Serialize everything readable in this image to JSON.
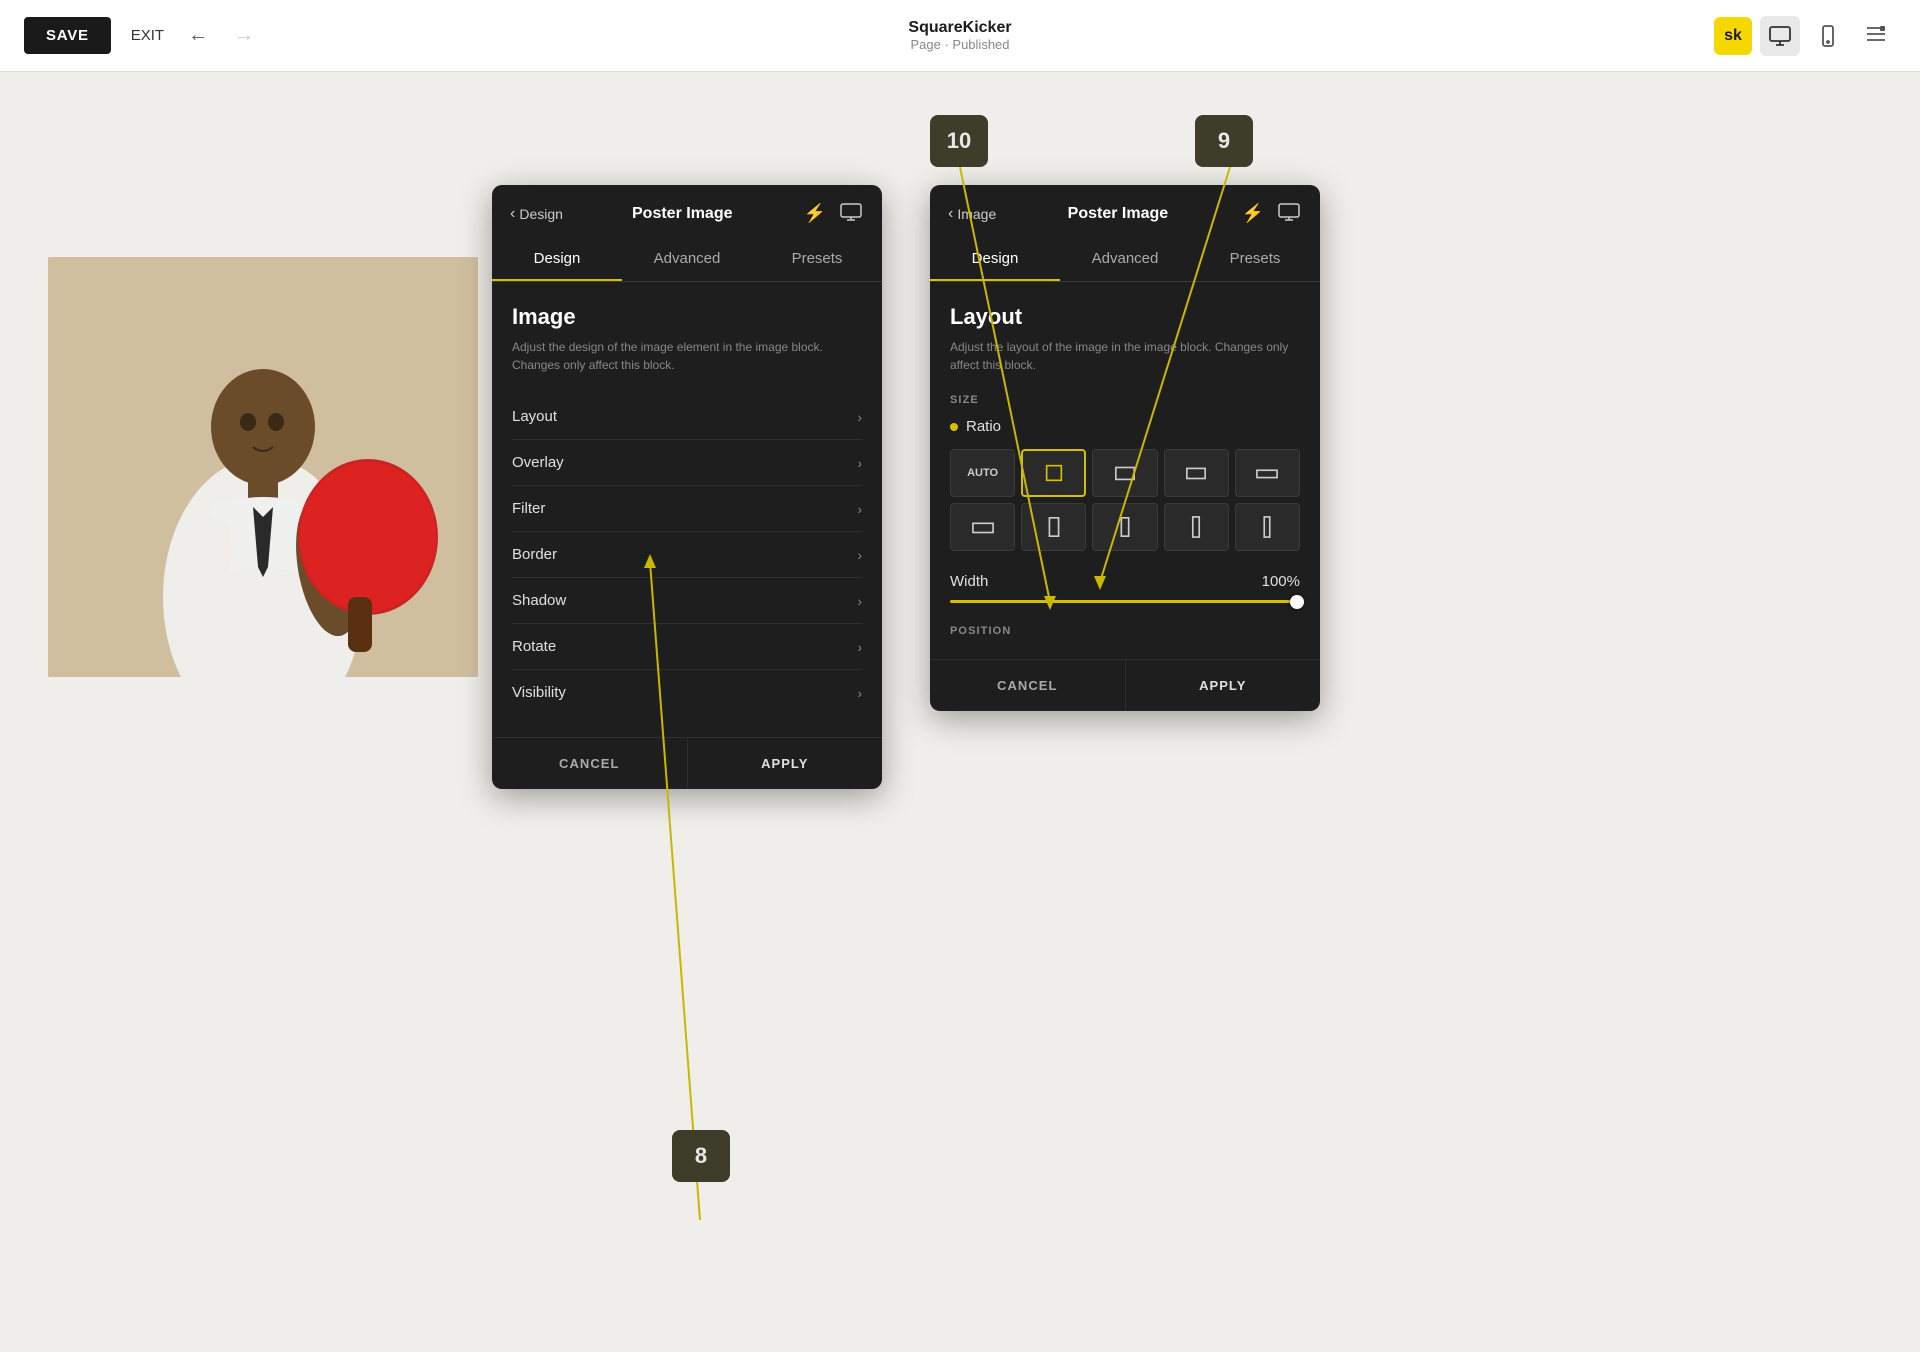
{
  "topbar": {
    "save_label": "SAVE",
    "exit_label": "EXIT",
    "title": "SquareKicker",
    "subtitle": "Page · Published",
    "sk_logo": "sk"
  },
  "left_panel": {
    "back_label": "Design",
    "title": "Poster Image",
    "tabs": [
      "Design",
      "Advanced",
      "Presets"
    ],
    "active_tab": 0,
    "section_title": "Image",
    "section_desc": "Adjust the design of the image element in the image block. Changes only affect this block.",
    "menu_items": [
      "Layout",
      "Overlay",
      "Filter",
      "Border",
      "Shadow",
      "Rotate",
      "Visibility"
    ],
    "cancel_label": "CANCEL",
    "apply_label": "APPLY"
  },
  "right_panel": {
    "back_label": "Image",
    "title": "Poster Image",
    "tabs": [
      "Design",
      "Advanced",
      "Presets"
    ],
    "active_tab": 0,
    "section_title": "Layout",
    "section_desc": "Adjust the layout of the image in the image block. Changes only affect this block.",
    "size_label": "SIZE",
    "ratio_label": "Ratio",
    "width_label": "Width",
    "width_value": "100%",
    "slider_percent": 97,
    "position_label": "POSITION",
    "cancel_label": "CANCEL",
    "apply_label": "APPLY",
    "ratio_options": [
      "AUTO",
      "sq1",
      "wide1",
      "wide2",
      "wider1",
      "short1",
      "tall1",
      "tall2",
      "tall3",
      "tallest1"
    ]
  },
  "badges": {
    "badge8": "8",
    "badge9": "9",
    "badge10": "10"
  }
}
